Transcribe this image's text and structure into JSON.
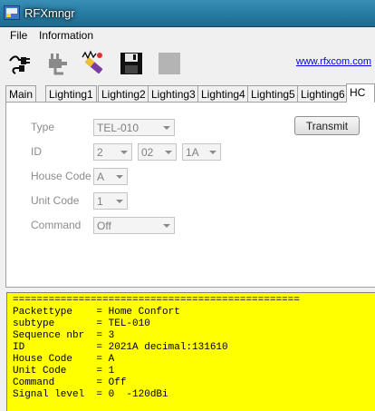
{
  "window": {
    "title": "RFXmngr"
  },
  "menu": {
    "file": "File",
    "information": "Information"
  },
  "toolbar": {
    "link": "www.rfxcom.com"
  },
  "tabs": [
    "Main",
    "Lighting1",
    "Lighting2",
    "Lighting3",
    "Lighting4",
    "Lighting5",
    "Lighting6",
    "HC"
  ],
  "form": {
    "type_label": "Type",
    "type_value": "TEL-010",
    "id_label": "ID",
    "id1": "2",
    "id2": "02",
    "id3": "1A",
    "house_code_label": "House Code",
    "house_code_value": "A",
    "unit_code_label": "Unit Code",
    "unit_code_value": "1",
    "command_label": "Command",
    "command_value": "Off",
    "transmit_label": "Transmit"
  },
  "log": {
    "lines": [
      "================================================",
      "Packettype    = Home Confort",
      "subtype       = TEL-010",
      "Sequence nbr  = 3",
      "ID            = 2021A decimal:131610",
      "House Code    = A",
      "Unit Code     = 1",
      "Command       = Off",
      "Signal level  = 0  -120dBi"
    ]
  },
  "colors": {
    "log_background": "#ffff00",
    "titlebar": "#2a7fa6"
  }
}
